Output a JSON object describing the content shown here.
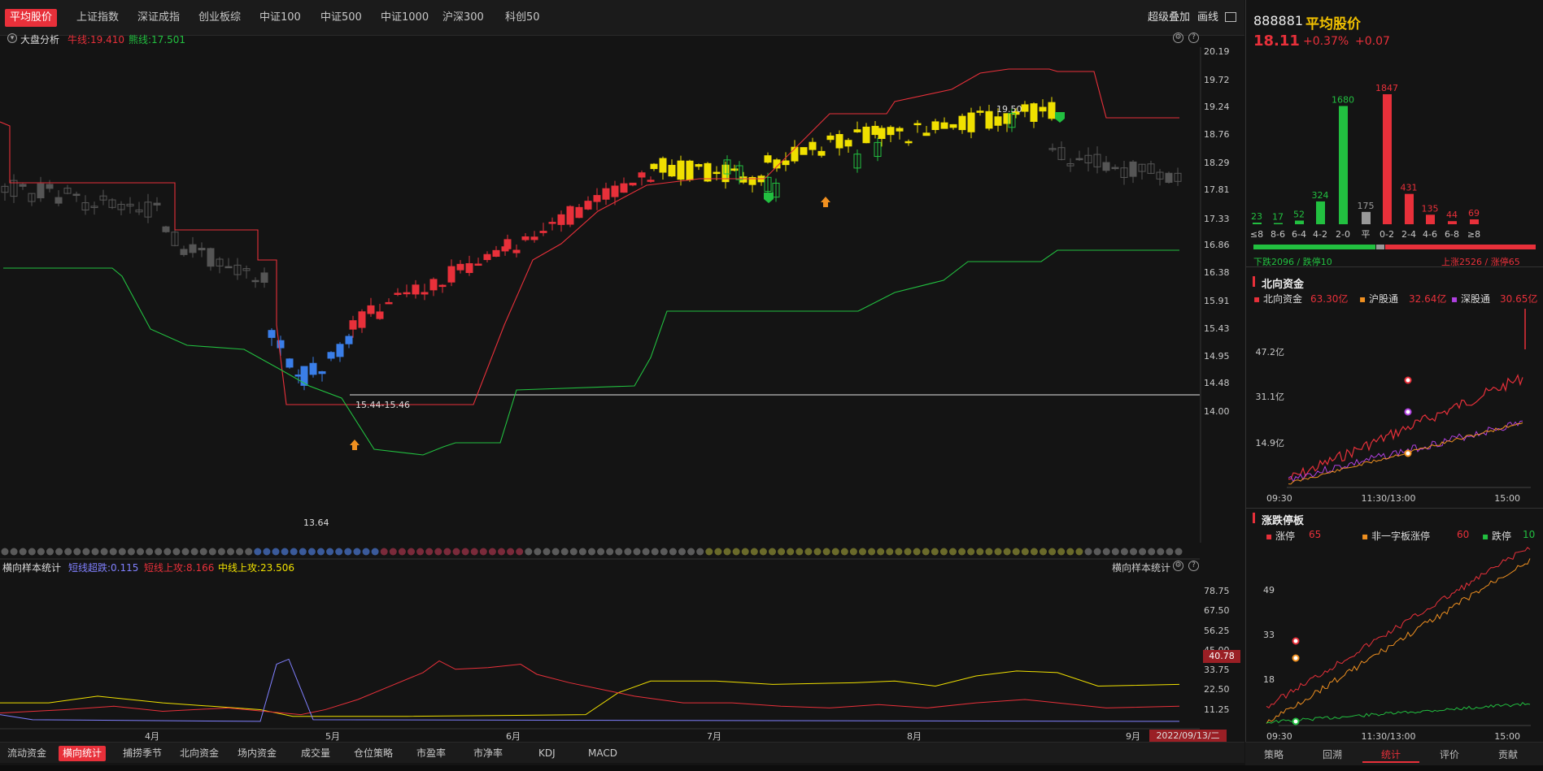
{
  "top_tabs": [
    "平均股价",
    "上证指数",
    "深证成指",
    "创业板综",
    "中证100",
    "中证500",
    "中证1000",
    "沪深300",
    "科创50"
  ],
  "top_right": {
    "overlay": "超级叠加",
    "draw": "画线"
  },
  "chart_header": {
    "title": "大盘分析",
    "bull_label": "牛线:19.410",
    "bear_label": "熊线:17.501",
    "help_icon": "?"
  },
  "main_axis": {
    "y_ticks": [
      "20.19",
      "19.72",
      "19.24",
      "18.76",
      "18.29",
      "17.81",
      "17.33",
      "16.86",
      "16.38",
      "15.91",
      "15.43",
      "14.95",
      "14.48",
      "14.00"
    ],
    "range_label": "15.44-15.46",
    "high_label": "19.50",
    "low_label": "13.64"
  },
  "lower_header": {
    "title": "横向样本统计",
    "short_down": "短线超跌:0.115",
    "short_up": "短线上攻:8.166",
    "mid_up": "中线上攻:23.506",
    "right_title": "横向样本统计"
  },
  "lower_axis": {
    "y_ticks": [
      "78.75",
      "67.50",
      "56.25",
      "45.00",
      "33.75",
      "22.50",
      "11.25"
    ],
    "current": "40.78"
  },
  "x_axis": {
    "months": [
      "4月",
      "5月",
      "6月",
      "7月",
      "8月",
      "9月"
    ],
    "date": "2022/09/13/二"
  },
  "bottom_tabs": [
    "流动资金",
    "横向统计",
    "捕捞季节",
    "北向资金",
    "场内资金",
    "成交量",
    "仓位策略",
    "市盈率",
    "市净率",
    "KDJ",
    "MACD"
  ],
  "quote": {
    "code": "888881",
    "name": "平均股价",
    "price": "18.11",
    "pct": "+0.37%",
    "chg": "+0.07"
  },
  "distribution": {
    "labels": [
      "≤8",
      "8-6",
      "6-4",
      "4-2",
      "2-0",
      "平",
      "0-2",
      "2-4",
      "4-6",
      "6-8",
      "≥8"
    ],
    "values": [
      23,
      17,
      52,
      324,
      1680,
      175,
      1847,
      431,
      135,
      44,
      69
    ],
    "down_text": "下跌2096 / 跌停10",
    "up_text": "上涨2526 / 涨停65"
  },
  "north": {
    "title": "北向资金",
    "total_label": "北向资金",
    "total_value": "63.30亿",
    "sh_label": "沪股通",
    "sh_value": "32.64亿",
    "sz_label": "深股通",
    "sz_value": "30.65亿",
    "y_ticks": [
      "47.2亿",
      "31.1亿",
      "14.9亿"
    ],
    "x_ticks": [
      "09:30",
      "11:30/13:00",
      "15:00"
    ]
  },
  "limit": {
    "title": "涨跌停板",
    "up_label": "涨停",
    "up_value": "65",
    "nonone_label": "非一字板涨停",
    "nonone_value": "60",
    "down_label": "跌停",
    "down_value": "10",
    "y_ticks": [
      "49",
      "33",
      "18"
    ],
    "x_ticks": [
      "09:30",
      "11:30/13:00",
      "15:00"
    ]
  },
  "right_bottom_tabs": [
    "策略",
    "回溯",
    "统计",
    "评价",
    "贡献"
  ],
  "colors": {
    "red": "#e8303a",
    "green": "#22c040",
    "yellow": "#f0e000",
    "blue": "#3a7ee8",
    "gray": "#666666"
  }
}
